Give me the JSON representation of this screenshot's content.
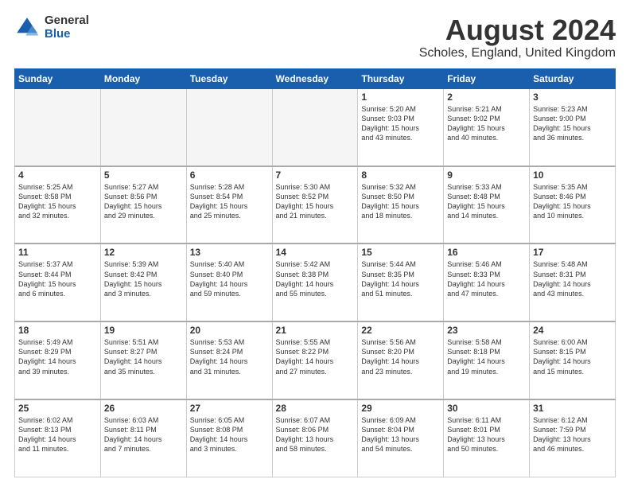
{
  "logo": {
    "general": "General",
    "blue": "Blue"
  },
  "title": "August 2024",
  "location": "Scholes, England, United Kingdom",
  "days_of_week": [
    "Sunday",
    "Monday",
    "Tuesday",
    "Wednesday",
    "Thursday",
    "Friday",
    "Saturday"
  ],
  "weeks": [
    [
      {
        "day": "",
        "info": ""
      },
      {
        "day": "",
        "info": ""
      },
      {
        "day": "",
        "info": ""
      },
      {
        "day": "",
        "info": ""
      },
      {
        "day": "1",
        "info": "Sunrise: 5:20 AM\nSunset: 9:03 PM\nDaylight: 15 hours\nand 43 minutes."
      },
      {
        "day": "2",
        "info": "Sunrise: 5:21 AM\nSunset: 9:02 PM\nDaylight: 15 hours\nand 40 minutes."
      },
      {
        "day": "3",
        "info": "Sunrise: 5:23 AM\nSunset: 9:00 PM\nDaylight: 15 hours\nand 36 minutes."
      }
    ],
    [
      {
        "day": "4",
        "info": "Sunrise: 5:25 AM\nSunset: 8:58 PM\nDaylight: 15 hours\nand 32 minutes."
      },
      {
        "day": "5",
        "info": "Sunrise: 5:27 AM\nSunset: 8:56 PM\nDaylight: 15 hours\nand 29 minutes."
      },
      {
        "day": "6",
        "info": "Sunrise: 5:28 AM\nSunset: 8:54 PM\nDaylight: 15 hours\nand 25 minutes."
      },
      {
        "day": "7",
        "info": "Sunrise: 5:30 AM\nSunset: 8:52 PM\nDaylight: 15 hours\nand 21 minutes."
      },
      {
        "day": "8",
        "info": "Sunrise: 5:32 AM\nSunset: 8:50 PM\nDaylight: 15 hours\nand 18 minutes."
      },
      {
        "day": "9",
        "info": "Sunrise: 5:33 AM\nSunset: 8:48 PM\nDaylight: 15 hours\nand 14 minutes."
      },
      {
        "day": "10",
        "info": "Sunrise: 5:35 AM\nSunset: 8:46 PM\nDaylight: 15 hours\nand 10 minutes."
      }
    ],
    [
      {
        "day": "11",
        "info": "Sunrise: 5:37 AM\nSunset: 8:44 PM\nDaylight: 15 hours\nand 6 minutes."
      },
      {
        "day": "12",
        "info": "Sunrise: 5:39 AM\nSunset: 8:42 PM\nDaylight: 15 hours\nand 3 minutes."
      },
      {
        "day": "13",
        "info": "Sunrise: 5:40 AM\nSunset: 8:40 PM\nDaylight: 14 hours\nand 59 minutes."
      },
      {
        "day": "14",
        "info": "Sunrise: 5:42 AM\nSunset: 8:38 PM\nDaylight: 14 hours\nand 55 minutes."
      },
      {
        "day": "15",
        "info": "Sunrise: 5:44 AM\nSunset: 8:35 PM\nDaylight: 14 hours\nand 51 minutes."
      },
      {
        "day": "16",
        "info": "Sunrise: 5:46 AM\nSunset: 8:33 PM\nDaylight: 14 hours\nand 47 minutes."
      },
      {
        "day": "17",
        "info": "Sunrise: 5:48 AM\nSunset: 8:31 PM\nDaylight: 14 hours\nand 43 minutes."
      }
    ],
    [
      {
        "day": "18",
        "info": "Sunrise: 5:49 AM\nSunset: 8:29 PM\nDaylight: 14 hours\nand 39 minutes."
      },
      {
        "day": "19",
        "info": "Sunrise: 5:51 AM\nSunset: 8:27 PM\nDaylight: 14 hours\nand 35 minutes."
      },
      {
        "day": "20",
        "info": "Sunrise: 5:53 AM\nSunset: 8:24 PM\nDaylight: 14 hours\nand 31 minutes."
      },
      {
        "day": "21",
        "info": "Sunrise: 5:55 AM\nSunset: 8:22 PM\nDaylight: 14 hours\nand 27 minutes."
      },
      {
        "day": "22",
        "info": "Sunrise: 5:56 AM\nSunset: 8:20 PM\nDaylight: 14 hours\nand 23 minutes."
      },
      {
        "day": "23",
        "info": "Sunrise: 5:58 AM\nSunset: 8:18 PM\nDaylight: 14 hours\nand 19 minutes."
      },
      {
        "day": "24",
        "info": "Sunrise: 6:00 AM\nSunset: 8:15 PM\nDaylight: 14 hours\nand 15 minutes."
      }
    ],
    [
      {
        "day": "25",
        "info": "Sunrise: 6:02 AM\nSunset: 8:13 PM\nDaylight: 14 hours\nand 11 minutes."
      },
      {
        "day": "26",
        "info": "Sunrise: 6:03 AM\nSunset: 8:11 PM\nDaylight: 14 hours\nand 7 minutes."
      },
      {
        "day": "27",
        "info": "Sunrise: 6:05 AM\nSunset: 8:08 PM\nDaylight: 14 hours\nand 3 minutes."
      },
      {
        "day": "28",
        "info": "Sunrise: 6:07 AM\nSunset: 8:06 PM\nDaylight: 13 hours\nand 58 minutes."
      },
      {
        "day": "29",
        "info": "Sunrise: 6:09 AM\nSunset: 8:04 PM\nDaylight: 13 hours\nand 54 minutes."
      },
      {
        "day": "30",
        "info": "Sunrise: 6:11 AM\nSunset: 8:01 PM\nDaylight: 13 hours\nand 50 minutes."
      },
      {
        "day": "31",
        "info": "Sunrise: 6:12 AM\nSunset: 7:59 PM\nDaylight: 13 hours\nand 46 minutes."
      }
    ]
  ]
}
